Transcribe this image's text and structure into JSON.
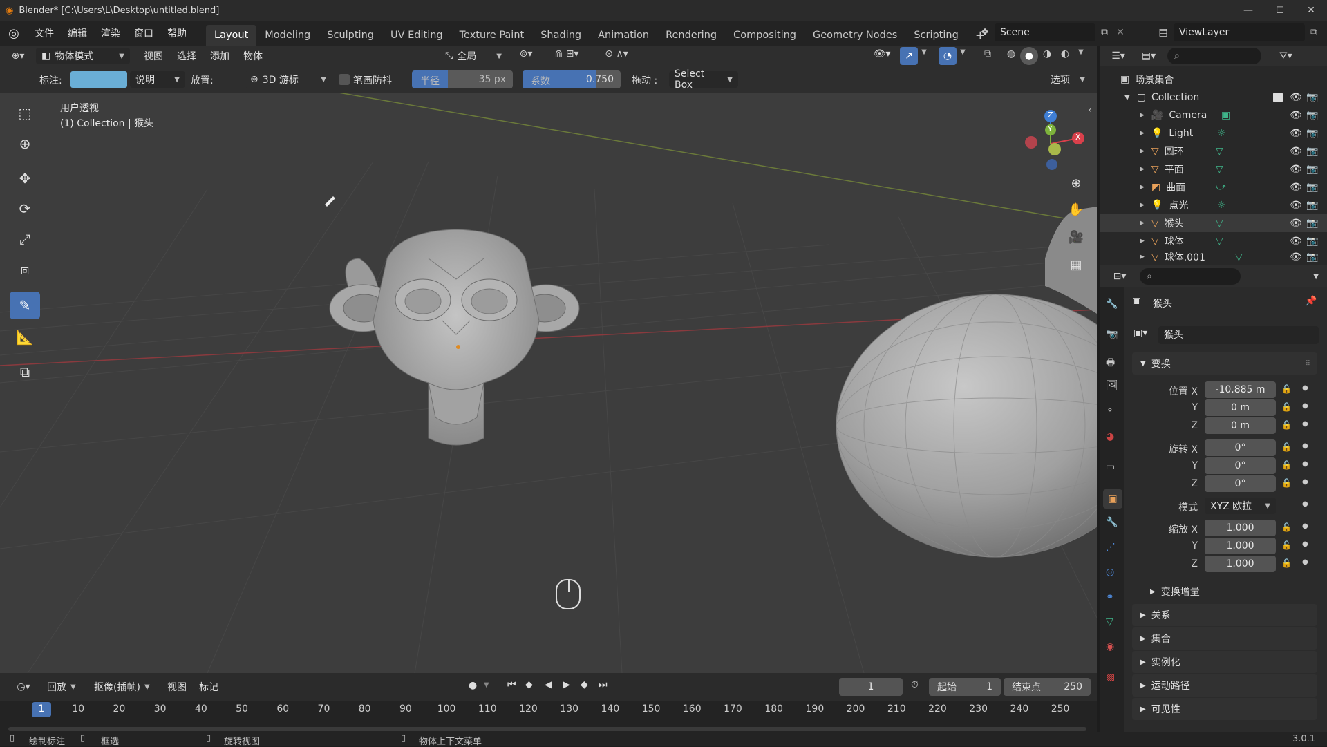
{
  "window": {
    "title": "Blender* [C:\\Users\\L\\Desktop\\untitled.blend]",
    "min_label": "—",
    "max_label": "☐",
    "close_label": "✕"
  },
  "menu": [
    "文件",
    "编辑",
    "渲染",
    "窗口",
    "帮助"
  ],
  "workspaces": [
    "Layout",
    "Modeling",
    "Sculpting",
    "UV Editing",
    "Texture Paint",
    "Shading",
    "Animation",
    "Rendering",
    "Compositing",
    "Geometry Nodes",
    "Scripting"
  ],
  "active_workspace": "Layout",
  "add_workspace": "+",
  "scene": {
    "label": "Scene"
  },
  "view_layer": {
    "label": "ViewLayer"
  },
  "header": {
    "mode": "物体模式",
    "menus": [
      "视图",
      "选择",
      "添加",
      "物体"
    ],
    "orientation": "全局"
  },
  "tool_settings": {
    "annotate_label": "标注:",
    "note_dropdown": "说明",
    "placement_label": "放置:",
    "placement_value": "3D 游标",
    "stabilize_label": "笔画防抖",
    "radius_label": "半径",
    "radius_value": "35 px",
    "factor_label": "系数",
    "factor_value": "0.750",
    "drag_label": "拖动 :",
    "drag_value": "Select Box",
    "options_label": "选项"
  },
  "viewport": {
    "view_name": "用户透视",
    "collection_info": "(1) Collection | 猴头",
    "gizmo": {
      "x": "X",
      "y": "Y",
      "z": "Z"
    }
  },
  "outliner": {
    "root": "场景集合",
    "collection": "Collection",
    "items": [
      "Camera",
      "Light",
      "圆环",
      "平面",
      "曲面",
      "点光",
      "猴头",
      "球体",
      "球体.001"
    ]
  },
  "properties": {
    "object_name": "猴头",
    "data_name": "猴头",
    "transform_title": "变换",
    "location_label": "位置 X",
    "location": [
      "-10.885 m",
      "0 m",
      "0 m"
    ],
    "rotation_label": "旋转 X",
    "rotation": [
      "0°",
      "0°",
      "0°"
    ],
    "mode_label": "模式",
    "mode_value": "XYZ 欧拉",
    "scale_label": "缩放 X",
    "scale": [
      "1.000",
      "1.000",
      "1.000"
    ],
    "axis_y": "Y",
    "axis_z": "Z",
    "delta_title": "变换增量",
    "sections": [
      "关系",
      "集合",
      "实例化",
      "运动路径",
      "可见性"
    ],
    "version": "3.0.1"
  },
  "timeline": {
    "menus": [
      "回放",
      "抠像(插帧)",
      "视图",
      "标记"
    ],
    "current_frame": "1",
    "start_label": "起始",
    "start_value": "1",
    "end_label": "结束点",
    "end_value": "250",
    "ticks": [
      "1",
      "10",
      "20",
      "30",
      "40",
      "50",
      "60",
      "70",
      "80",
      "90",
      "100",
      "110",
      "120",
      "130",
      "140",
      "150",
      "160",
      "170",
      "180",
      "190",
      "200",
      "210",
      "220",
      "230",
      "240",
      "250"
    ]
  },
  "status": {
    "draw": "绘制标注",
    "box": "框选",
    "rotate": "旋转视图",
    "context": "物体上下文菜单"
  },
  "colors": {
    "accent": "#4772b3",
    "x_axis": "#d9404b",
    "y_axis": "#7eb33c",
    "z_axis": "#3f7ed4"
  }
}
